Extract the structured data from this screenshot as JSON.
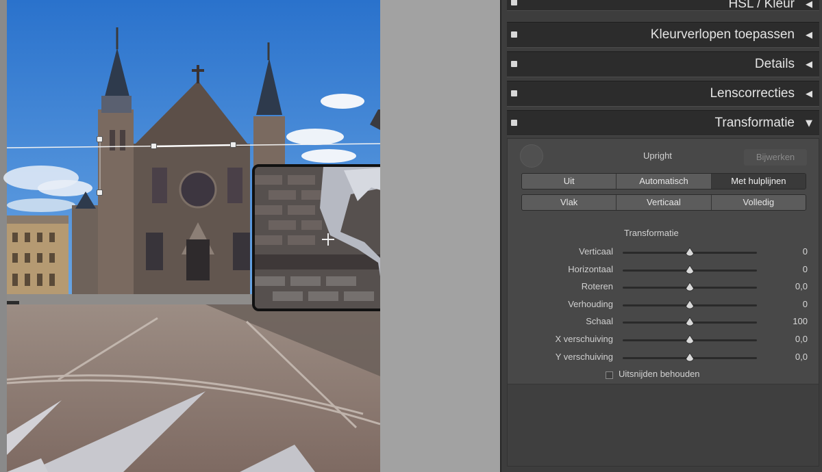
{
  "panel": {
    "sections": [
      {
        "title": "HSL / Kleur",
        "state": "collapsed"
      },
      {
        "title": "Kleurverlopen toepassen",
        "state": "collapsed"
      },
      {
        "title": "Details",
        "state": "collapsed"
      },
      {
        "title": "Lenscorrecties",
        "state": "collapsed"
      },
      {
        "title": "Transformatie",
        "state": "expanded"
      }
    ],
    "transform": {
      "upright_label": "Upright",
      "update_button": "Bijwerken",
      "upright_modes_row1": [
        "Uit",
        "Automatisch",
        "Met hulplijnen"
      ],
      "upright_modes_row2": [
        "Vlak",
        "Verticaal",
        "Volledig"
      ],
      "selected_mode": "Met hulplijnen",
      "subheading": "Transformatie",
      "sliders": [
        {
          "name": "Verticaal",
          "value": "0",
          "level": 0.5
        },
        {
          "name": "Horizontaal",
          "value": "0",
          "level": 0.5
        },
        {
          "name": "Roteren",
          "value": "0,0",
          "level": 0.5
        },
        {
          "name": "Verhouding",
          "value": "0",
          "level": 0.5
        },
        {
          "name": "Schaal",
          "value": "100",
          "level": 0.5
        },
        {
          "name": "X verschuiving",
          "value": "0,0",
          "level": 0.5
        },
        {
          "name": "Y verschuiving",
          "value": "0,0",
          "level": 0.5
        }
      ],
      "keep_crop_label": "Uitsnijden behouden",
      "keep_crop_checked": false
    }
  },
  "icons": {
    "collapsed": "triangle-left-icon",
    "expanded": "triangle-down-icon",
    "loupe_cursor": "crosshair-icon"
  },
  "colors": {
    "panel_bg": "#3d3d3d",
    "header_bg": "#2c2c2c",
    "sky": "#2f78cf"
  }
}
